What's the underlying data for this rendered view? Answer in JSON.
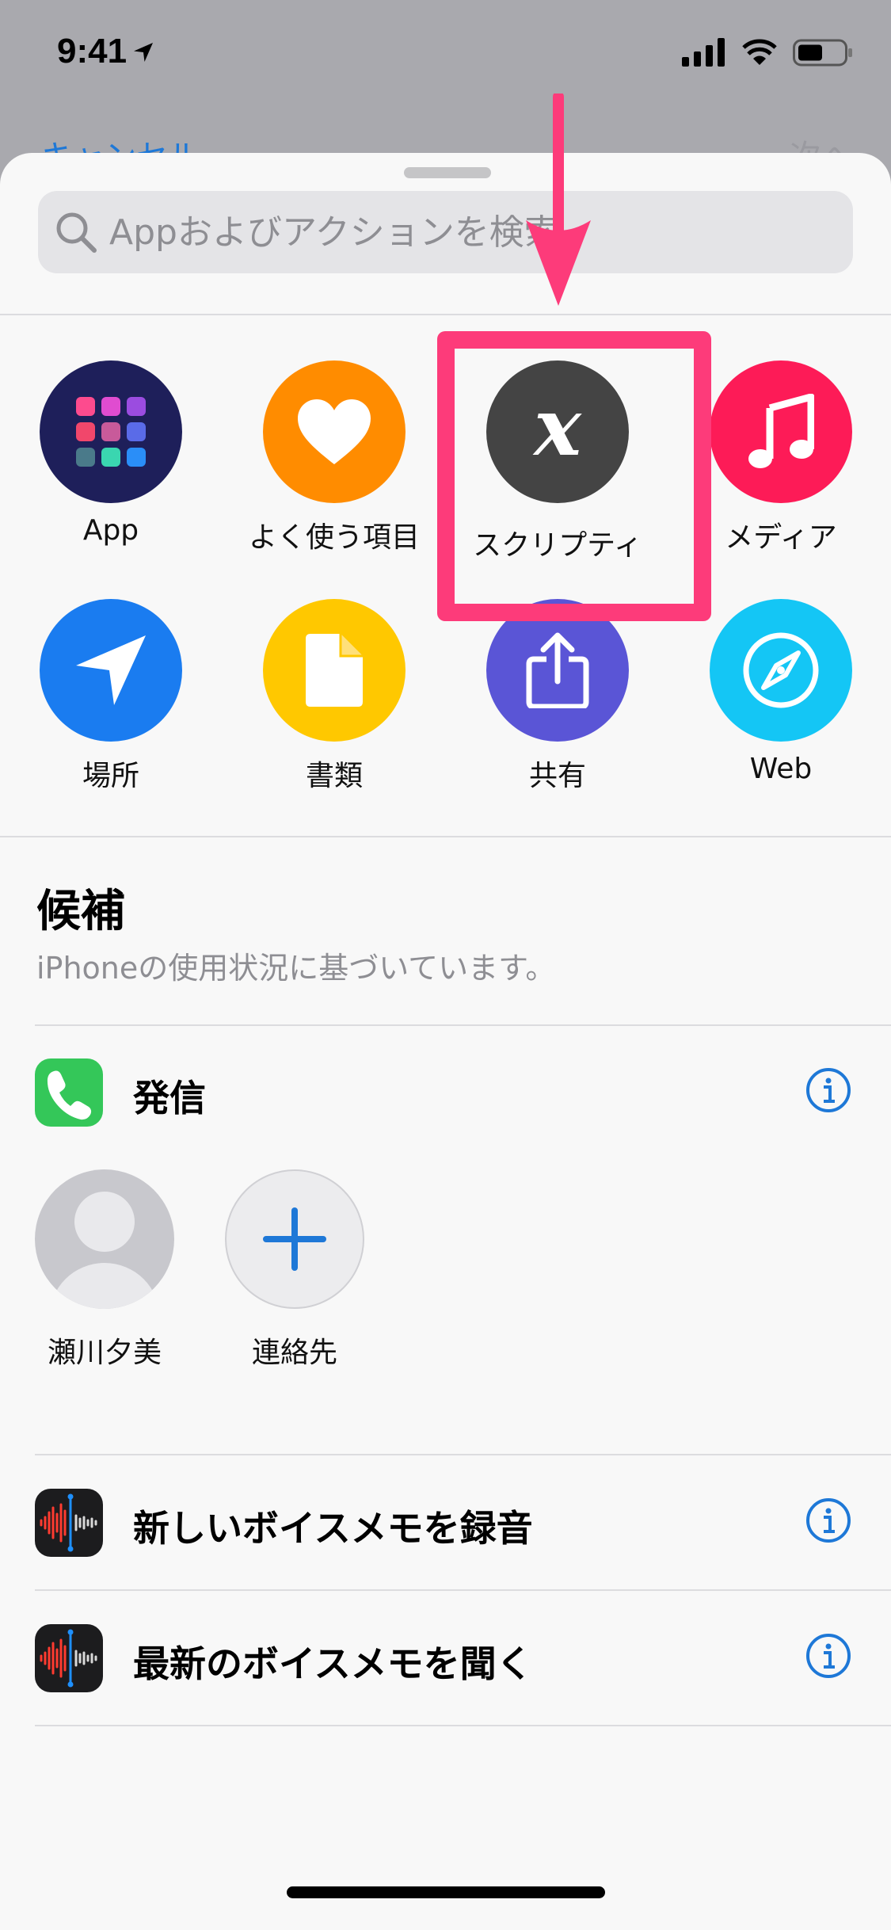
{
  "status_bar": {
    "time": "9:41"
  },
  "behind_sheet": {
    "left_label": "キャンセル",
    "right_label": "次へ"
  },
  "search": {
    "placeholder": "Appおよびアクションを検索"
  },
  "categories": [
    {
      "label": "App",
      "color": "#1e1f5a",
      "icon": "app-grid-icon"
    },
    {
      "label": "よく使う項目",
      "color": "#ff8c00",
      "icon": "heart-icon"
    },
    {
      "label": "スクリプティ",
      "color": "#444444",
      "icon": "variable-x-icon"
    },
    {
      "label": "メディア",
      "color": "#fd1b57",
      "icon": "music-note-icon"
    },
    {
      "label": "場所",
      "color": "#1a7cf0",
      "icon": "location-arrow-icon"
    },
    {
      "label": "書類",
      "color": "#ffc800",
      "icon": "document-icon"
    },
    {
      "label": "共有",
      "color": "#5a55d6",
      "icon": "share-icon"
    },
    {
      "label": "Web",
      "color": "#14c6f5",
      "icon": "compass-icon"
    }
  ],
  "suggestions": {
    "title": "候補",
    "subtitle": "iPhoneの使用状況に基づいています。",
    "call": {
      "label": "発信"
    },
    "contacts": [
      {
        "name": "瀬川夕美"
      },
      {
        "name": "連絡先"
      }
    ],
    "actions": [
      {
        "label": "新しいボイスメモを録音"
      },
      {
        "label": "最新のボイスメモを聞く"
      }
    ]
  },
  "colors": {
    "accent": "#1e78d7",
    "highlight": "#fd3b7a"
  }
}
